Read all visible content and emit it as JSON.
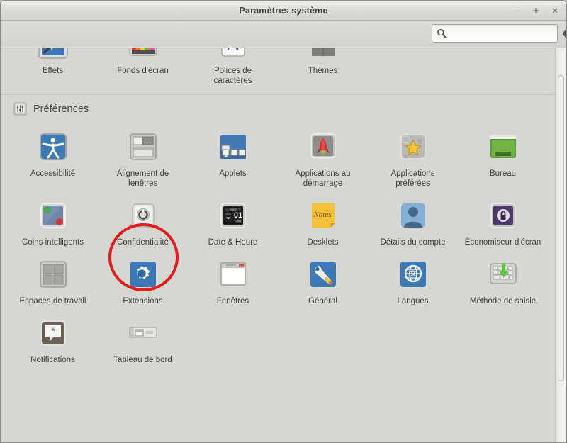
{
  "window": {
    "title": "Paramètres système",
    "buttons": [
      {
        "name": "minimize",
        "glyph": "−"
      },
      {
        "name": "maximize",
        "glyph": "+"
      },
      {
        "name": "close",
        "glyph": "×"
      }
    ]
  },
  "search": {
    "value": "",
    "placeholder": "",
    "icon": "search-icon",
    "clear_icon": "clear-icon"
  },
  "colors": {
    "window_bg": "#d6d6d2",
    "titlebar": "#dcdcd8",
    "annotation_red": "#e41b1b",
    "text": "#3f3f3f"
  },
  "annotation": {
    "shape": "ellipse",
    "target": "Confidentialité",
    "color": "#e41b1b"
  },
  "sections": [
    {
      "id": "apparence",
      "header": null,
      "header_icon": null,
      "partial": true,
      "items": [
        {
          "label": "Effets",
          "icon": "effects-icon"
        },
        {
          "label": "Fonds d'écran",
          "icon": "wallpaper-icon"
        },
        {
          "label": "Polices de\ncaractères",
          "icon": "fonts-icon"
        },
        {
          "label": "Thèmes",
          "icon": "themes-icon"
        }
      ]
    },
    {
      "id": "preferences",
      "header": "Préférences",
      "header_icon": "preferences-icon",
      "partial": false,
      "items": [
        {
          "label": "Accessibilité",
          "icon": "accessibility-icon"
        },
        {
          "label": "Alignement de fenêtres",
          "icon": "window-tiling-icon"
        },
        {
          "label": "Applets",
          "icon": "applets-icon"
        },
        {
          "label": "Applications au démarrage",
          "icon": "startup-applications-icon"
        },
        {
          "label": "Applications préférées",
          "icon": "preferred-applications-icon"
        },
        {
          "label": "Bureau",
          "icon": "desktop-icon"
        },
        {
          "label": "Coins intelligents",
          "icon": "hot-corners-icon"
        },
        {
          "label": "Confidentialité",
          "icon": "privacy-icon"
        },
        {
          "label": "Date & Heure",
          "icon": "date-time-icon"
        },
        {
          "label": "Desklets",
          "icon": "desklets-icon"
        },
        {
          "label": "Détails du compte",
          "icon": "account-details-icon"
        },
        {
          "label": "Économiseur d'écran",
          "icon": "screensaver-icon"
        },
        {
          "label": "Espaces de travail",
          "icon": "workspaces-icon"
        },
        {
          "label": "Extensions",
          "icon": "extensions-icon"
        },
        {
          "label": "Fenêtres",
          "icon": "windows-icon"
        },
        {
          "label": "Général",
          "icon": "general-icon"
        },
        {
          "label": "Langues",
          "icon": "languages-icon"
        },
        {
          "label": "Méthode de saisie",
          "icon": "input-method-icon"
        },
        {
          "label": "Notifications",
          "icon": "notifications-icon"
        },
        {
          "label": "Tableau de bord",
          "icon": "panel-icon"
        }
      ]
    }
  ],
  "scrollbar": {
    "orientation": "vertical",
    "position": "partially-scrolled"
  }
}
